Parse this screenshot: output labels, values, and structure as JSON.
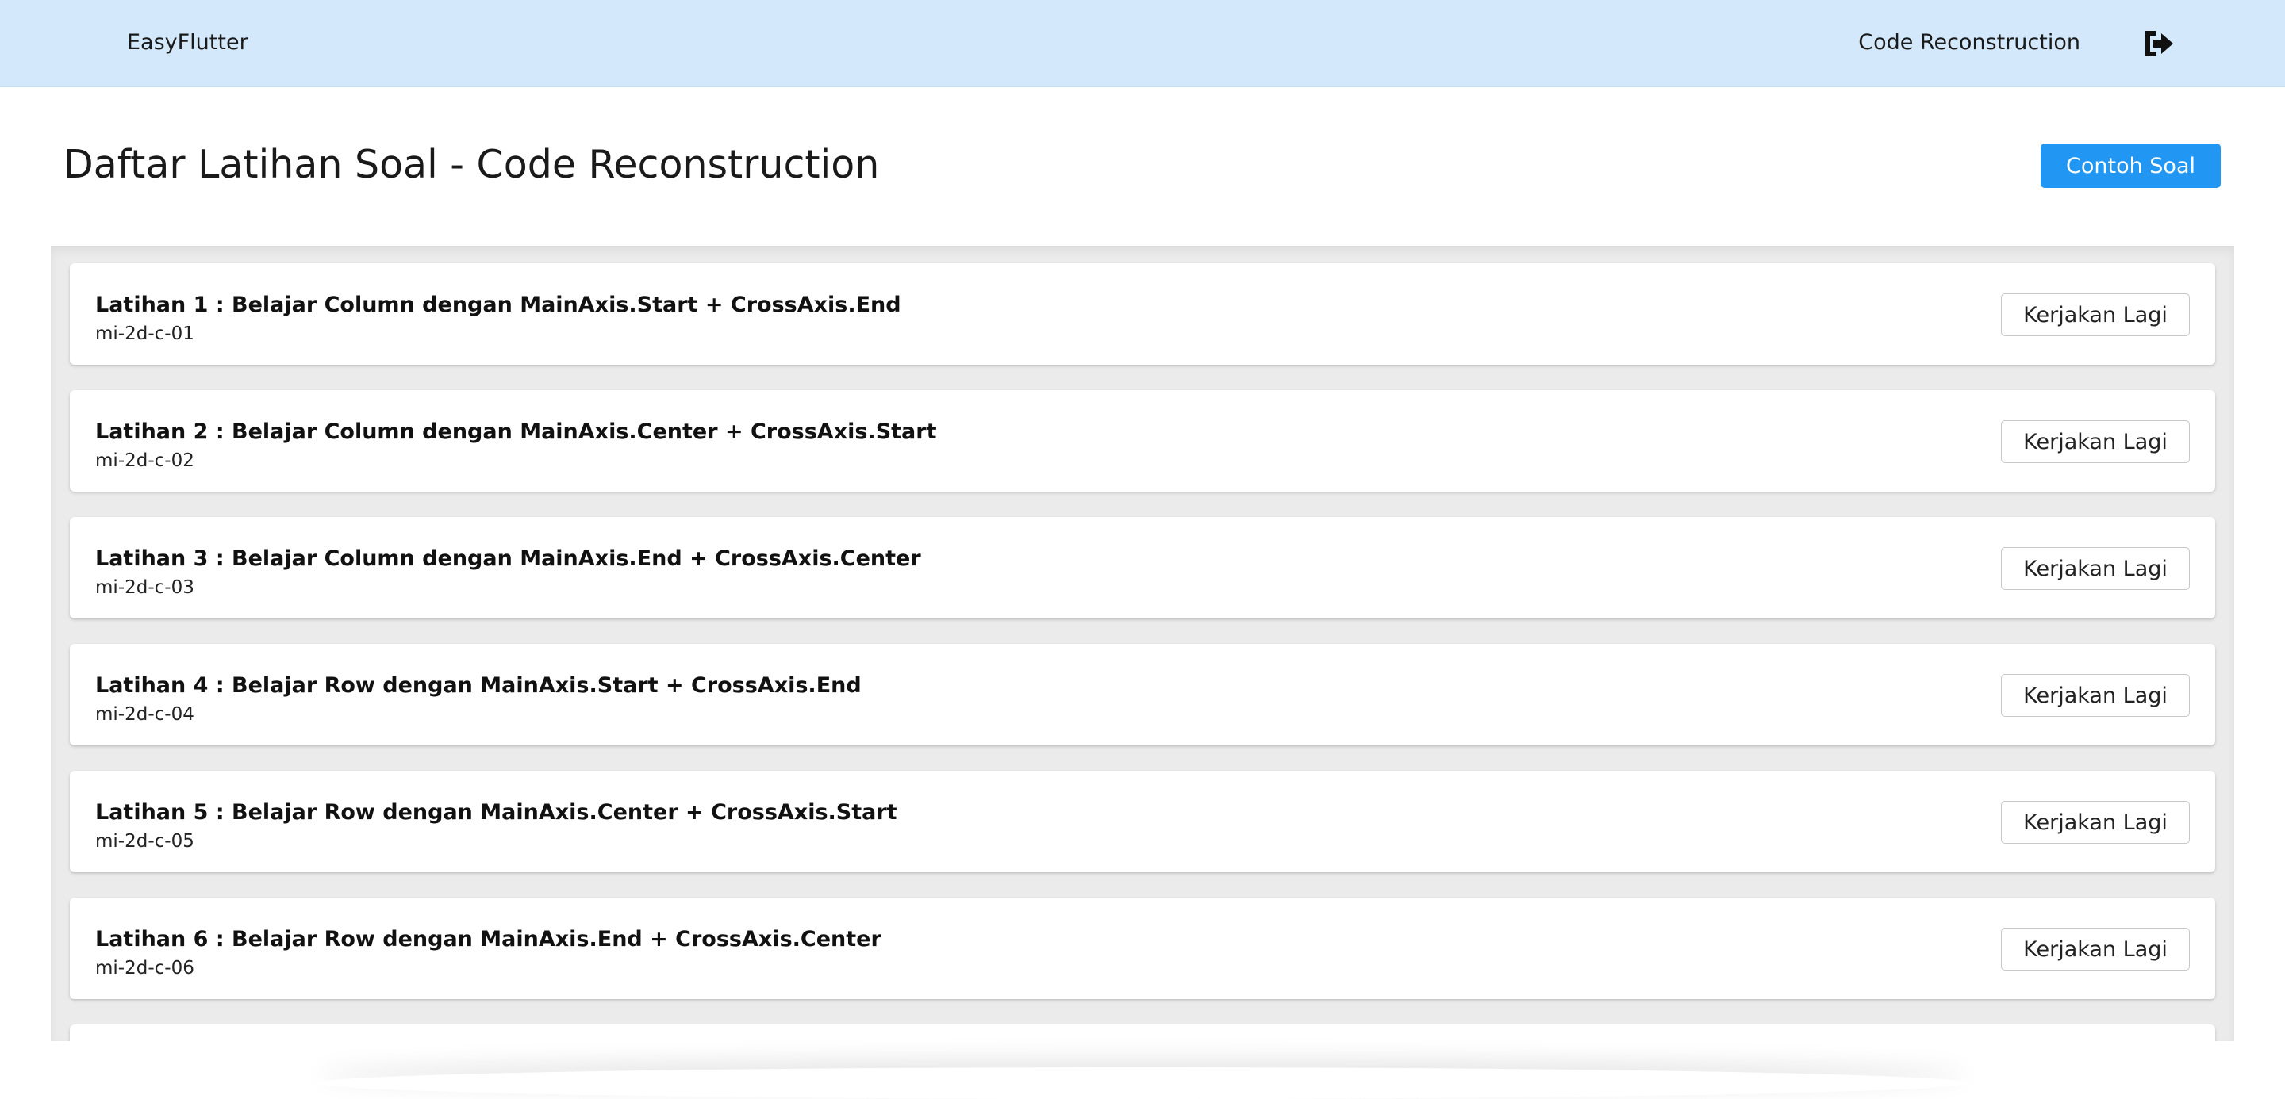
{
  "navbar": {
    "brand": "EasyFlutter",
    "link": "Code Reconstruction",
    "logout_icon": "sign-out-icon"
  },
  "header": {
    "title": "Daftar Latihan Soal - Code Reconstruction",
    "example_button": "Contoh Soal"
  },
  "exercises": [
    {
      "title": "Latihan 1 : Belajar Column dengan MainAxis.Start + CrossAxis.End",
      "code": "mi-2d-c-01",
      "action": "Kerjakan Lagi"
    },
    {
      "title": "Latihan 2 : Belajar Column dengan MainAxis.Center + CrossAxis.Start",
      "code": "mi-2d-c-02",
      "action": "Kerjakan Lagi"
    },
    {
      "title": "Latihan 3 : Belajar Column dengan MainAxis.End + CrossAxis.Center",
      "code": "mi-2d-c-03",
      "action": "Kerjakan Lagi"
    },
    {
      "title": "Latihan 4 : Belajar Row dengan MainAxis.Start + CrossAxis.End",
      "code": "mi-2d-c-04",
      "action": "Kerjakan Lagi"
    },
    {
      "title": "Latihan 5 : Belajar Row dengan MainAxis.Center + CrossAxis.Start",
      "code": "mi-2d-c-05",
      "action": "Kerjakan Lagi"
    },
    {
      "title": "Latihan 6 : Belajar Row dengan MainAxis.End + CrossAxis.Center",
      "code": "mi-2d-c-06",
      "action": "Kerjakan Lagi"
    }
  ],
  "colors": {
    "navbar_bg": "#d3e8fa",
    "primary": "#2196f3",
    "panel_bg": "#ebebeb"
  }
}
